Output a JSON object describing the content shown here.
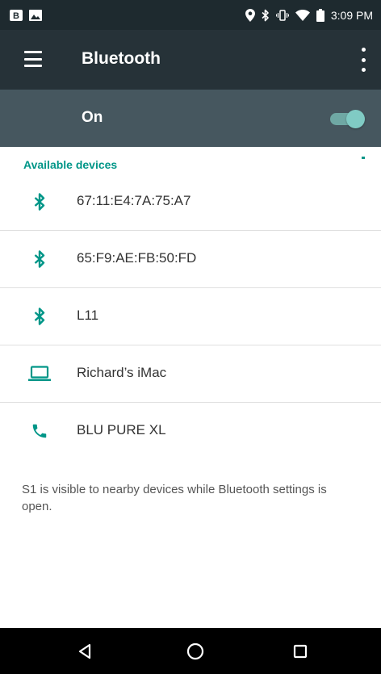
{
  "status_bar": {
    "time": "3:09 PM",
    "left_icons": [
      "b-notification-icon",
      "image-notification-icon"
    ],
    "right_icons": [
      "location-icon",
      "bluetooth-status-icon",
      "vibrate-icon",
      "wifi-icon",
      "battery-icon"
    ]
  },
  "app_bar": {
    "title": "Bluetooth",
    "menu_icon": "hamburger-menu-icon",
    "overflow_icon": "more-vert-icon"
  },
  "switch_bar": {
    "label": "On",
    "state": "on",
    "accent_color": "#80cbc4"
  },
  "available_devices": {
    "header": "Available devices",
    "items": [
      {
        "icon": "bluetooth-icon",
        "label": "67:11:E4:7A:75:A7"
      },
      {
        "icon": "bluetooth-icon",
        "label": "65:F9:AE:FB:50:FD"
      },
      {
        "icon": "bluetooth-icon",
        "label": "L11"
      },
      {
        "icon": "laptop-icon",
        "label": "Richard’s iMac"
      },
      {
        "icon": "phone-icon",
        "label": "BLU PURE XL"
      }
    ]
  },
  "footer_text": "S1 is visible to nearby devices while Bluetooth settings is open.",
  "nav_bar": {
    "buttons": [
      "back-icon",
      "home-icon",
      "recents-icon"
    ]
  },
  "colors": {
    "status_bar": "#1e2a2f",
    "app_bar": "#263238",
    "switch_bar": "#46575f",
    "accent": "#009688"
  }
}
